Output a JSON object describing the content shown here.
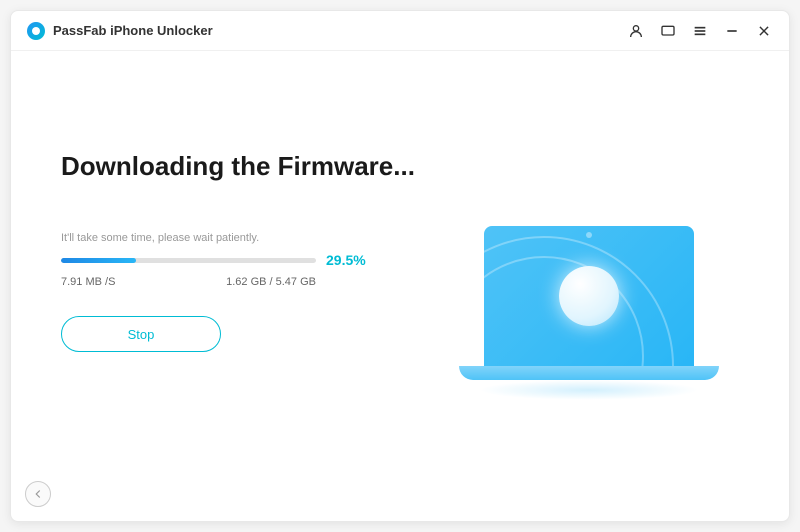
{
  "app": {
    "title": "PassFab iPhone Unlocker"
  },
  "main": {
    "heading": "Downloading the Firmware...",
    "hint": "It'll take some time, please wait patiently.",
    "progress": {
      "percent": "29.5%",
      "percent_value": 29.5,
      "speed": "7.91 MB /S",
      "size": "1.62 GB / 5.47 GB"
    },
    "stop_label": "Stop"
  },
  "icons": {
    "user": "user-icon",
    "feedback": "feedback-icon",
    "menu": "menu-icon",
    "minimize": "minimize-icon",
    "close": "close-icon",
    "back": "back-arrow-icon"
  }
}
